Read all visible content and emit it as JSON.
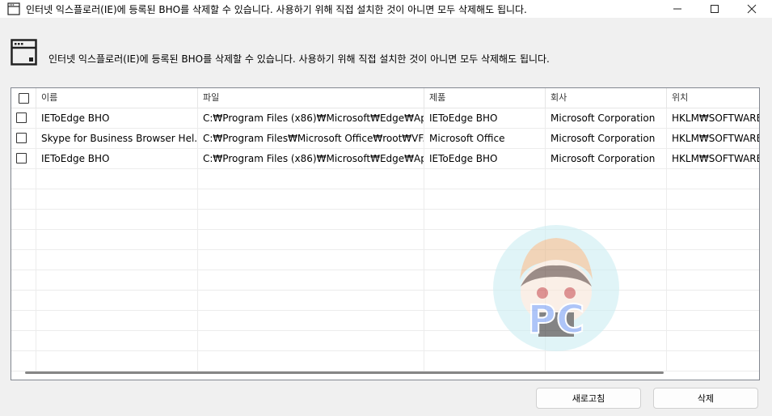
{
  "window": {
    "title": "인터넷 익스플로러(IE)에 등록된 BHO를 삭제할 수 있습니다. 사용하기 위해 직접 설치한 것이 아니면 모두 삭제해도 됩니다."
  },
  "header": {
    "message": "인터넷 익스플로러(IE)에 등록된 BHO를 삭제할 수 있습니다. 사용하기 위해 직접 설치한 것이 아니면 모두 삭제해도 됩니다."
  },
  "table": {
    "columns": [
      "이름",
      "파일",
      "제품",
      "회사",
      "위치"
    ],
    "rows": [
      [
        "IEToEdge BHO",
        "C:₩Program Files (x86)₩Microsoft₩Edge₩Ap...",
        "IEToEdge BHO",
        "Microsoft Corporation",
        "HKLM₩SOFTWARE₩"
      ],
      [
        "Skype for Business Browser Hel...",
        "C:₩Program Files₩Microsoft Office₩root₩VF...",
        "Microsoft Office",
        "Microsoft Corporation",
        "HKLM₩SOFTWARE₩"
      ],
      [
        "IEToEdge BHO",
        "C:₩Program Files (x86)₩Microsoft₩Edge₩Ap...",
        "IEToEdge BHO",
        "Microsoft Corporation",
        "HKLM₩SOFTWARE₩"
      ]
    ]
  },
  "buttons": {
    "refresh": "새로고침",
    "delete": "삭제"
  },
  "watermark": {
    "text": "PC",
    "icon": "mascot-watermark-icon"
  },
  "colors": {
    "background": "#f0f0f0",
    "watermark_blue": "#7a9ff5",
    "watermark_circle": "#cdeef2"
  }
}
